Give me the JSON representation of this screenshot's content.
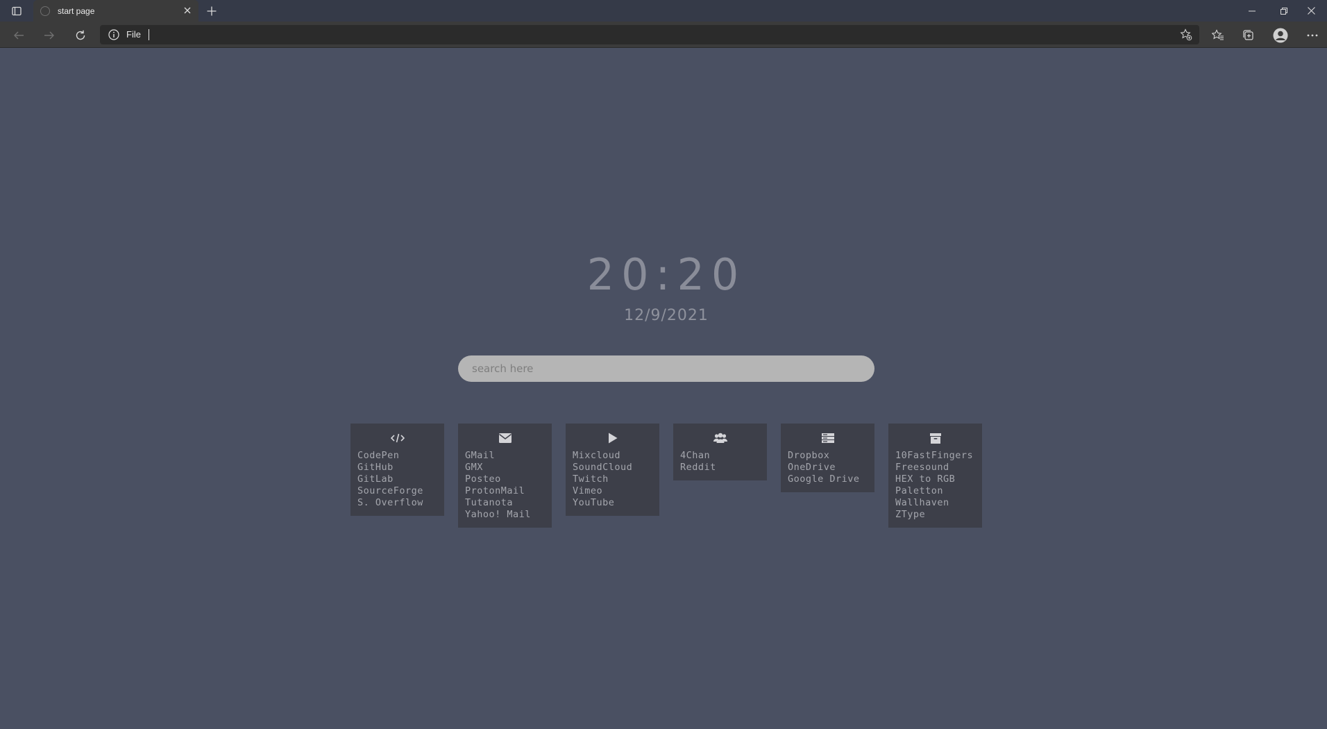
{
  "browser": {
    "tab_title": "start page",
    "address_prefix": "File"
  },
  "page": {
    "clock": "20:20",
    "date": "12/9/2021",
    "search_placeholder": "search here"
  },
  "cards": [
    {
      "icon": "code-icon",
      "links": [
        "CodePen",
        "GitHub",
        "GitLab",
        "SourceForge",
        "S. Overflow"
      ]
    },
    {
      "icon": "envelope-icon",
      "links": [
        "GMail",
        "GMX",
        "Posteo",
        "ProtonMail",
        "Tutanota",
        "Yahoo! Mail"
      ]
    },
    {
      "icon": "play-icon",
      "links": [
        "Mixcloud",
        "SoundCloud",
        "Twitch",
        "Vimeo",
        "YouTube"
      ]
    },
    {
      "icon": "users-icon",
      "links": [
        "4Chan",
        "Reddit"
      ]
    },
    {
      "icon": "server-icon",
      "links": [
        "Dropbox",
        "OneDrive",
        "Google Drive"
      ]
    },
    {
      "icon": "archive-icon",
      "links": [
        "10FastFingers",
        "Freesound",
        "HEX to RGB",
        "Paletton",
        "Wallhaven",
        "ZType"
      ]
    }
  ]
}
